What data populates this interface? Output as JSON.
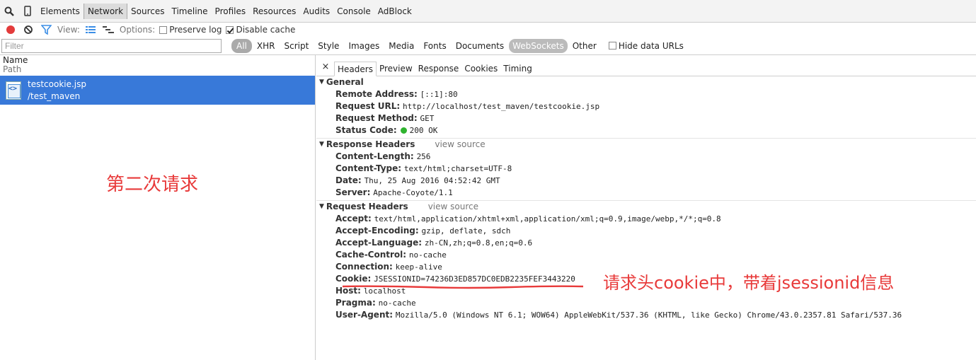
{
  "topbar": {
    "tabs": [
      "Elements",
      "Network",
      "Sources",
      "Timeline",
      "Profiles",
      "Resources",
      "Audits",
      "Console",
      "AdBlock"
    ],
    "selected": "Network",
    "icons": [
      "search-icon",
      "device-icon"
    ]
  },
  "toolbar": {
    "view_label": "View:",
    "options_label": "Options:",
    "preserve_log": "Preserve log",
    "disable_cache": "Disable cache",
    "record_color": "#e33b3b",
    "filter_icon_color": "#3b8ee6"
  },
  "filter": {
    "placeholder": "Filter",
    "types": [
      "All",
      "XHR",
      "Script",
      "Style",
      "Images",
      "Media",
      "Fonts",
      "Documents",
      "WebSockets",
      "Other"
    ],
    "hide_data_urls": "Hide data URLs"
  },
  "requests": {
    "col_name": "Name",
    "col_path": "Path",
    "items": [
      {
        "name": "testcookie.jsp",
        "path": "/test_maven"
      }
    ],
    "selected_color": "#3879d9"
  },
  "detail_tabs": [
    "Headers",
    "Preview",
    "Response",
    "Cookies",
    "Timing"
  ],
  "general": {
    "title": "General",
    "rows": [
      {
        "k": "Remote Address:",
        "v": "[::1]:80"
      },
      {
        "k": "Request URL:",
        "v": "http://localhost/test_maven/testcookie.jsp"
      },
      {
        "k": "Request Method:",
        "v": "GET"
      },
      {
        "k": "Status Code:",
        "v": "200 OK"
      }
    ]
  },
  "response_headers": {
    "title": "Response Headers",
    "view_source": "view source",
    "rows": [
      {
        "k": "Content-Length:",
        "v": "256"
      },
      {
        "k": "Content-Type:",
        "v": "text/html;charset=UTF-8"
      },
      {
        "k": "Date:",
        "v": "Thu, 25 Aug 2016 04:52:42 GMT"
      },
      {
        "k": "Server:",
        "v": "Apache-Coyote/1.1"
      }
    ]
  },
  "request_headers": {
    "title": "Request Headers",
    "view_source": "view source",
    "rows": [
      {
        "k": "Accept:",
        "v": "text/html,application/xhtml+xml,application/xml;q=0.9,image/webp,*/*;q=0.8"
      },
      {
        "k": "Accept-Encoding:",
        "v": "gzip, deflate, sdch"
      },
      {
        "k": "Accept-Language:",
        "v": "zh-CN,zh;q=0.8,en;q=0.6"
      },
      {
        "k": "Cache-Control:",
        "v": "no-cache"
      },
      {
        "k": "Connection:",
        "v": "keep-alive"
      },
      {
        "k": "Cookie:",
        "v": "JSESSIONID=74236D3ED857DC0EDB2235FEF3443220"
      },
      {
        "k": "Host:",
        "v": "localhost"
      },
      {
        "k": "Pragma:",
        "v": "no-cache"
      },
      {
        "k": "User-Agent:",
        "v": "Mozilla/5.0 (Windows NT 6.1; WOW64) AppleWebKit/537.36 (KHTML, like Gecko) Chrome/43.0.2357.81 Safari/537.36"
      }
    ]
  },
  "annotations": {
    "left": "第二次请求",
    "right": "请求头cookie中，带着jsessionid信息",
    "color": "#e83a3a"
  }
}
